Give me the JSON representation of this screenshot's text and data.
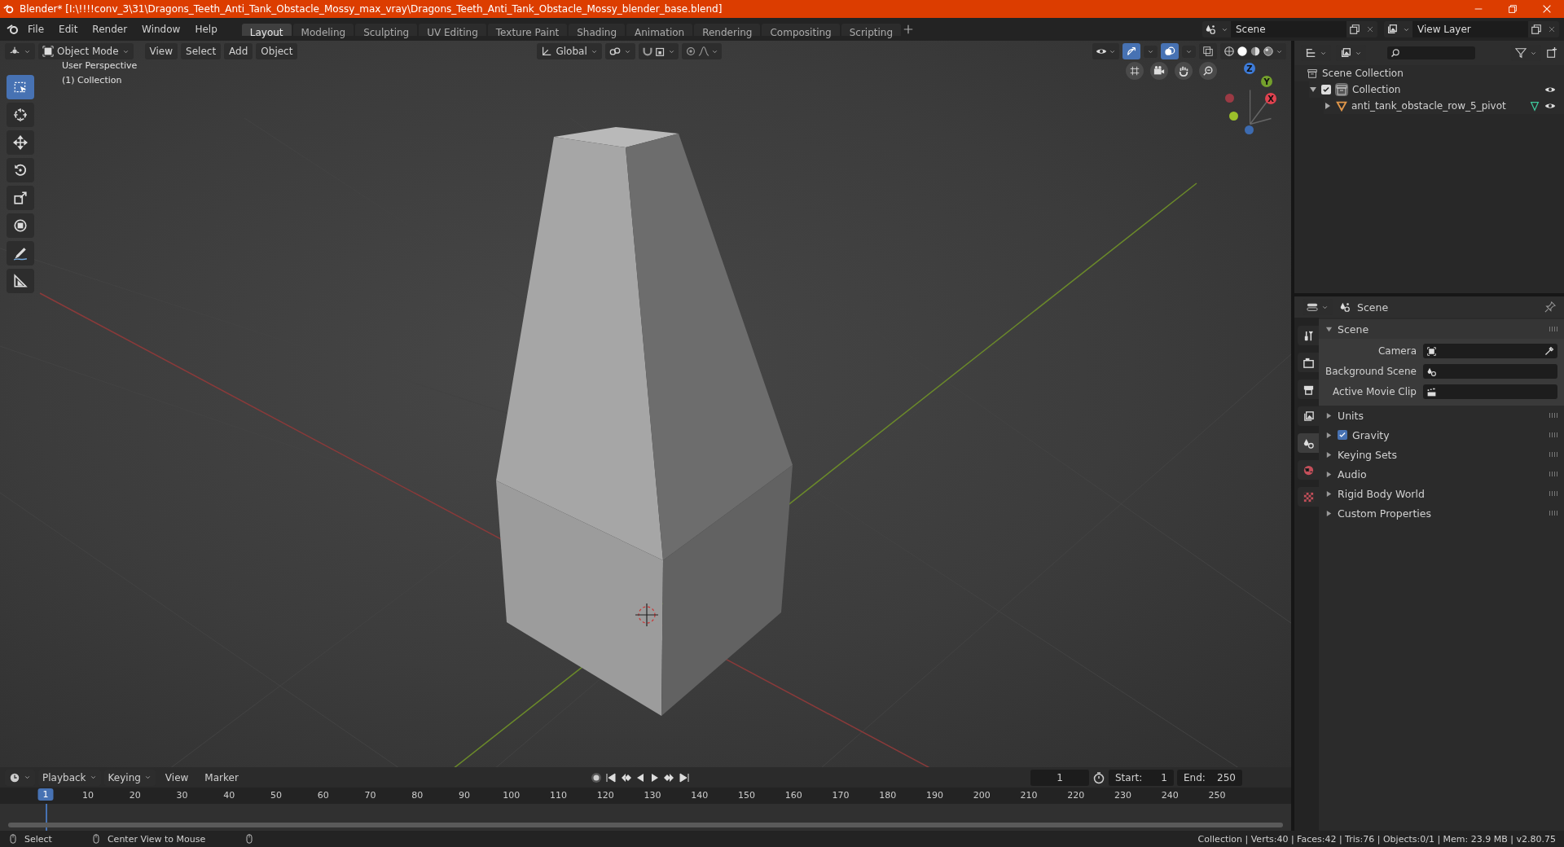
{
  "window": {
    "title": "Blender* [I:\\!!!!conv_3\\31\\Dragons_Teeth_Anti_Tank_Obstacle_Mossy_max_vray\\Dragons_Teeth_Anti_Tank_Obstacle_Mossy_blender_base.blend]"
  },
  "menu": [
    "File",
    "Edit",
    "Render",
    "Window",
    "Help"
  ],
  "workspaces": [
    {
      "label": "Layout",
      "selected": true
    },
    {
      "label": "Modeling",
      "selected": false
    },
    {
      "label": "Sculpting",
      "selected": false
    },
    {
      "label": "UV Editing",
      "selected": false
    },
    {
      "label": "Texture Paint",
      "selected": false
    },
    {
      "label": "Shading",
      "selected": false
    },
    {
      "label": "Animation",
      "selected": false
    },
    {
      "label": "Rendering",
      "selected": false
    },
    {
      "label": "Compositing",
      "selected": false
    },
    {
      "label": "Scripting",
      "selected": false
    }
  ],
  "scene_selector": {
    "value": "Scene"
  },
  "view_layer_selector": {
    "value": "View Layer"
  },
  "viewport": {
    "mode": "Object Mode",
    "menus": [
      "View",
      "Select",
      "Add",
      "Object"
    ],
    "orientation": "Global",
    "overlay_text": [
      "User Perspective",
      "(1) Collection"
    ],
    "tools": [
      {
        "kind": "select",
        "selected": true
      },
      {
        "kind": "cursor",
        "selected": false
      },
      {
        "kind": "move",
        "selected": false
      },
      {
        "kind": "rotate",
        "selected": false
      },
      {
        "kind": "scale",
        "selected": false
      },
      {
        "kind": "transform",
        "selected": false
      },
      {
        "kind": "annotate",
        "selected": false
      },
      {
        "kind": "measure",
        "selected": false
      }
    ],
    "gizmo_axes": [
      "Z",
      "Y",
      "X"
    ]
  },
  "outliner": {
    "items": [
      {
        "label": "Scene Collection",
        "kind": "scene-collection",
        "children": [
          {
            "label": "Collection",
            "kind": "collection",
            "checked": true,
            "expanded": true,
            "children": [
              {
                "label": "anti_tank_obstacle_row_5_pivot",
                "kind": "object",
                "expanded": false
              }
            ]
          }
        ]
      }
    ]
  },
  "properties": {
    "context": "Scene",
    "tabs": [
      {
        "kind": "tool",
        "selected": false
      },
      {
        "kind": "render",
        "selected": false
      },
      {
        "kind": "output",
        "selected": false
      },
      {
        "kind": "view-layer",
        "selected": false
      },
      {
        "kind": "scene",
        "selected": true
      },
      {
        "kind": "world",
        "selected": false
      },
      {
        "kind": "texture",
        "selected": false
      }
    ],
    "panels": [
      {
        "title": "Scene",
        "expanded": true,
        "kind": "plain",
        "fields": [
          {
            "label": "Camera",
            "kind": "camera"
          },
          {
            "label": "Background Scene",
            "kind": "scene"
          },
          {
            "label": "Active Movie Clip",
            "kind": "clip"
          }
        ]
      },
      {
        "title": "Units",
        "expanded": false,
        "kind": "plain"
      },
      {
        "title": "Gravity",
        "expanded": false,
        "kind": "checkbox",
        "checked": true
      },
      {
        "title": "Keying Sets",
        "expanded": false,
        "kind": "plain"
      },
      {
        "title": "Audio",
        "expanded": false,
        "kind": "plain"
      },
      {
        "title": "Rigid Body World",
        "expanded": false,
        "kind": "plain"
      },
      {
        "title": "Custom Properties",
        "expanded": false,
        "kind": "plain"
      }
    ]
  },
  "timeline": {
    "menus": [
      "Playback",
      "Keying",
      "View",
      "Marker"
    ],
    "current_frame": "1",
    "start_label": "Start:",
    "start": "1",
    "end_label": "End:",
    "end": "250",
    "playhead": "1",
    "ruler": [
      "10",
      "20",
      "30",
      "40",
      "50",
      "60",
      "70",
      "80",
      "90",
      "100",
      "110",
      "120",
      "130",
      "140",
      "150",
      "160",
      "170",
      "180",
      "190",
      "200",
      "210",
      "220",
      "230",
      "240",
      "250"
    ]
  },
  "status_bar": {
    "left": [
      "Select",
      "Center View to Mouse"
    ],
    "right": "Collection | Verts:40 | Faces:42 | Tris:76 | Objects:0/1 | Mem: 23.9 MB | v2.80.75"
  }
}
